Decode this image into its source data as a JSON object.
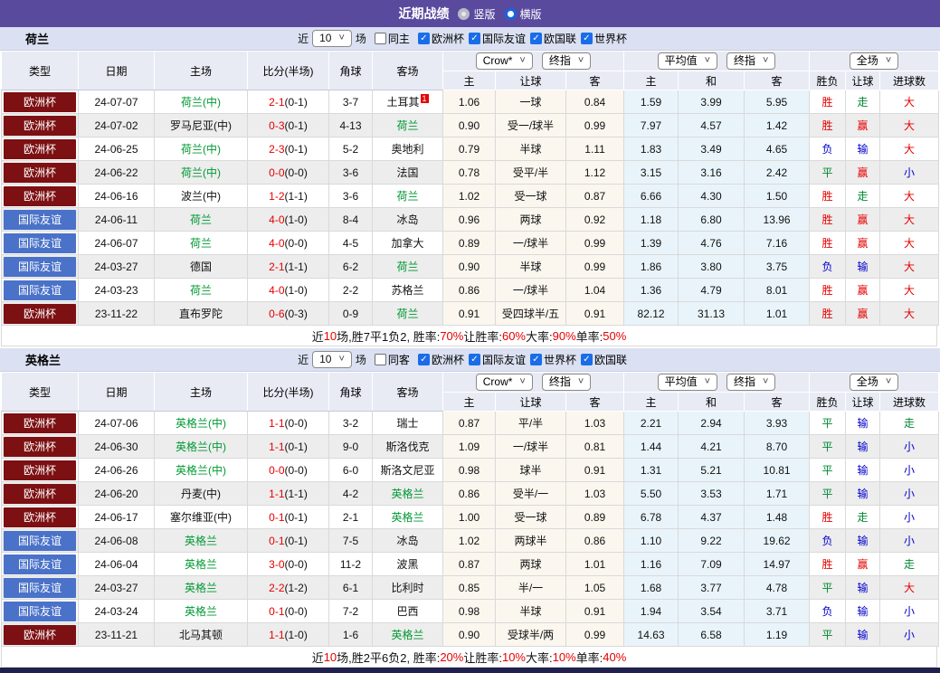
{
  "colors": {
    "title_bar": "#5a4a9e",
    "team_bar": "#dbe1f2",
    "header_cell": "#e8ebf4",
    "euro_badge": "#7c1012",
    "friendly_badge": "#4a72c8",
    "green_team": "#009933",
    "green_result": "#008833",
    "red_text": "#e60000",
    "blue_text": "#0000cc",
    "cream_bg": "#fbf7ef",
    "lightblue_bg": "#e9f4fa",
    "stripe": "#ededed",
    "checkbox_blue": "#1a6de8",
    "bottom_strip": "#20204e"
  },
  "title_bar": {
    "title": "近期战绩",
    "radio_vertical": "竖版",
    "radio_horizontal": "横版"
  },
  "columns": {
    "left": [
      "类型",
      "日期",
      "主场",
      "比分(半场)",
      "角球",
      "客场"
    ],
    "sub": [
      "主",
      "让球",
      "客",
      "主",
      "和",
      "客",
      "胜负",
      "让球",
      "进球数"
    ],
    "dropdowns": {
      "company": "Crow*",
      "final1": "终指",
      "avg": "平均值",
      "final2": "终指",
      "scope": "全场"
    }
  },
  "tables": [
    {
      "team": "荷兰",
      "filter": {
        "near": "近",
        "count": "10",
        "unit": "场",
        "same": "同主",
        "leagues": [
          "欧洲杯",
          "国际友谊",
          "欧国联",
          "世界杯"
        ]
      },
      "rows": [
        {
          "type": "欧洲杯",
          "date": "24-07-07",
          "home": "荷兰(中)",
          "hg": 1,
          "score": "2-1",
          "half": "(0-1)",
          "corner": "3-7",
          "away": "土耳其",
          "ag": 0,
          "note": "1",
          "o1": "1.06",
          "hc": "一球",
          "o2": "0.84",
          "m1": "1.59",
          "m2": "3.99",
          "m3": "5.95",
          "r1": "胜",
          "r2": "走",
          "r3": "大"
        },
        {
          "type": "欧洲杯",
          "date": "24-07-02",
          "home": "罗马尼亚(中)",
          "hg": 0,
          "score": "0-3",
          "half": "(0-1)",
          "corner": "4-13",
          "away": "荷兰",
          "ag": 1,
          "o1": "0.90",
          "hc": "受一/球半",
          "o2": "0.99",
          "m1": "7.97",
          "m2": "4.57",
          "m3": "1.42",
          "r1": "胜",
          "r2": "赢",
          "r3": "大"
        },
        {
          "type": "欧洲杯",
          "date": "24-06-25",
          "home": "荷兰(中)",
          "hg": 1,
          "score": "2-3",
          "half": "(0-1)",
          "corner": "5-2",
          "away": "奥地利",
          "ag": 0,
          "o1": "0.79",
          "hc": "半球",
          "o2": "1.11",
          "m1": "1.83",
          "m2": "3.49",
          "m3": "4.65",
          "r1": "负",
          "r2": "输",
          "r3": "大"
        },
        {
          "type": "欧洲杯",
          "date": "24-06-22",
          "home": "荷兰(中)",
          "hg": 1,
          "score": "0-0",
          "half": "(0-0)",
          "corner": "3-6",
          "away": "法国",
          "ag": 0,
          "o1": "0.78",
          "hc": "受平/半",
          "o2": "1.12",
          "m1": "3.15",
          "m2": "3.16",
          "m3": "2.42",
          "r1": "平",
          "r2": "赢",
          "r3": "小"
        },
        {
          "type": "欧洲杯",
          "date": "24-06-16",
          "home": "波兰(中)",
          "hg": 0,
          "score": "1-2",
          "half": "(1-1)",
          "corner": "3-6",
          "away": "荷兰",
          "ag": 1,
          "o1": "1.02",
          "hc": "受一球",
          "o2": "0.87",
          "m1": "6.66",
          "m2": "4.30",
          "m3": "1.50",
          "r1": "胜",
          "r2": "走",
          "r3": "大"
        },
        {
          "type": "国际友谊",
          "date": "24-06-11",
          "home": "荷兰",
          "hg": 1,
          "score": "4-0",
          "half": "(1-0)",
          "corner": "8-4",
          "away": "冰岛",
          "ag": 0,
          "o1": "0.96",
          "hc": "两球",
          "o2": "0.92",
          "m1": "1.18",
          "m2": "6.80",
          "m3": "13.96",
          "r1": "胜",
          "r2": "赢",
          "r3": "大"
        },
        {
          "type": "国际友谊",
          "date": "24-06-07",
          "home": "荷兰",
          "hg": 1,
          "score": "4-0",
          "half": "(0-0)",
          "corner": "4-5",
          "away": "加拿大",
          "ag": 0,
          "o1": "0.89",
          "hc": "一/球半",
          "o2": "0.99",
          "m1": "1.39",
          "m2": "4.76",
          "m3": "7.16",
          "r1": "胜",
          "r2": "赢",
          "r3": "大"
        },
        {
          "type": "国际友谊",
          "date": "24-03-27",
          "home": "德国",
          "hg": 0,
          "score": "2-1",
          "half": "(1-1)",
          "corner": "6-2",
          "away": "荷兰",
          "ag": 1,
          "o1": "0.90",
          "hc": "半球",
          "o2": "0.99",
          "m1": "1.86",
          "m2": "3.80",
          "m3": "3.75",
          "r1": "负",
          "r2": "输",
          "r3": "大"
        },
        {
          "type": "国际友谊",
          "date": "24-03-23",
          "home": "荷兰",
          "hg": 1,
          "score": "4-0",
          "half": "(1-0)",
          "corner": "2-2",
          "away": "苏格兰",
          "ag": 0,
          "o1": "0.86",
          "hc": "一/球半",
          "o2": "1.04",
          "m1": "1.36",
          "m2": "4.79",
          "m3": "8.01",
          "r1": "胜",
          "r2": "赢",
          "r3": "大"
        },
        {
          "type": "欧洲杯",
          "date": "23-11-22",
          "home": "直布罗陀",
          "hg": 0,
          "score": "0-6",
          "half": "(0-3)",
          "corner": "0-9",
          "away": "荷兰",
          "ag": 1,
          "o1": "0.91",
          "hc": "受四球半/五",
          "o2": "0.91",
          "m1": "82.12",
          "m2": "31.13",
          "m3": "1.01",
          "r1": "胜",
          "r2": "赢",
          "r3": "大"
        }
      ],
      "summary": [
        {
          "t": "近"
        },
        {
          "t": "10",
          "r": 1
        },
        {
          "t": "场,胜7平1负2, 胜率:"
        },
        {
          "t": "70%",
          "r": 1
        },
        {
          "t": " 让胜率:"
        },
        {
          "t": "60%",
          "r": 1
        },
        {
          "t": " 大率:"
        },
        {
          "t": "90%",
          "r": 1
        },
        {
          "t": " 单率:"
        },
        {
          "t": "50%",
          "r": 1
        }
      ]
    },
    {
      "team": "英格兰",
      "filter": {
        "near": "近",
        "count": "10",
        "unit": "场",
        "same": "同客",
        "leagues": [
          "欧洲杯",
          "国际友谊",
          "世界杯",
          "欧国联"
        ]
      },
      "rows": [
        {
          "type": "欧洲杯",
          "date": "24-07-06",
          "home": "英格兰(中)",
          "hg": 1,
          "score": "1-1",
          "half": "(0-0)",
          "corner": "3-2",
          "away": "瑞士",
          "ag": 0,
          "o1": "0.87",
          "hc": "平/半",
          "o2": "1.03",
          "m1": "2.21",
          "m2": "2.94",
          "m3": "3.93",
          "r1": "平",
          "r2": "输",
          "r3": "走"
        },
        {
          "type": "欧洲杯",
          "date": "24-06-30",
          "home": "英格兰(中)",
          "hg": 1,
          "score": "1-1",
          "half": "(0-1)",
          "corner": "9-0",
          "away": "斯洛伐克",
          "ag": 0,
          "o1": "1.09",
          "hc": "一/球半",
          "o2": "0.81",
          "m1": "1.44",
          "m2": "4.21",
          "m3": "8.70",
          "r1": "平",
          "r2": "输",
          "r3": "小"
        },
        {
          "type": "欧洲杯",
          "date": "24-06-26",
          "home": "英格兰(中)",
          "hg": 1,
          "score": "0-0",
          "half": "(0-0)",
          "corner": "6-0",
          "away": "斯洛文尼亚",
          "ag": 0,
          "o1": "0.98",
          "hc": "球半",
          "o2": "0.91",
          "m1": "1.31",
          "m2": "5.21",
          "m3": "10.81",
          "r1": "平",
          "r2": "输",
          "r3": "小"
        },
        {
          "type": "欧洲杯",
          "date": "24-06-20",
          "home": "丹麦(中)",
          "hg": 0,
          "score": "1-1",
          "half": "(1-1)",
          "corner": "4-2",
          "away": "英格兰",
          "ag": 1,
          "o1": "0.86",
          "hc": "受半/一",
          "o2": "1.03",
          "m1": "5.50",
          "m2": "3.53",
          "m3": "1.71",
          "r1": "平",
          "r2": "输",
          "r3": "小"
        },
        {
          "type": "欧洲杯",
          "date": "24-06-17",
          "home": "塞尔维亚(中)",
          "hg": 0,
          "score": "0-1",
          "half": "(0-1)",
          "corner": "2-1",
          "away": "英格兰",
          "ag": 1,
          "o1": "1.00",
          "hc": "受一球",
          "o2": "0.89",
          "m1": "6.78",
          "m2": "4.37",
          "m3": "1.48",
          "r1": "胜",
          "r2": "走",
          "r3": "小"
        },
        {
          "type": "国际友谊",
          "date": "24-06-08",
          "home": "英格兰",
          "hg": 1,
          "score": "0-1",
          "half": "(0-1)",
          "corner": "7-5",
          "away": "冰岛",
          "ag": 0,
          "o1": "1.02",
          "hc": "两球半",
          "o2": "0.86",
          "m1": "1.10",
          "m2": "9.22",
          "m3": "19.62",
          "r1": "负",
          "r2": "输",
          "r3": "小"
        },
        {
          "type": "国际友谊",
          "date": "24-06-04",
          "home": "英格兰",
          "hg": 1,
          "score": "3-0",
          "half": "(0-0)",
          "corner": "11-2",
          "away": "波黑",
          "ag": 0,
          "o1": "0.87",
          "hc": "两球",
          "o2": "1.01",
          "m1": "1.16",
          "m2": "7.09",
          "m3": "14.97",
          "r1": "胜",
          "r2": "赢",
          "r3": "走"
        },
        {
          "type": "国际友谊",
          "date": "24-03-27",
          "home": "英格兰",
          "hg": 1,
          "score": "2-2",
          "half": "(1-2)",
          "corner": "6-1",
          "away": "比利时",
          "ag": 0,
          "o1": "0.85",
          "hc": "半/一",
          "o2": "1.05",
          "m1": "1.68",
          "m2": "3.77",
          "m3": "4.78",
          "r1": "平",
          "r2": "输",
          "r3": "大"
        },
        {
          "type": "国际友谊",
          "date": "24-03-24",
          "home": "英格兰",
          "hg": 1,
          "score": "0-1",
          "half": "(0-0)",
          "corner": "7-2",
          "away": "巴西",
          "ag": 0,
          "o1": "0.98",
          "hc": "半球",
          "o2": "0.91",
          "m1": "1.94",
          "m2": "3.54",
          "m3": "3.71",
          "r1": "负",
          "r2": "输",
          "r3": "小"
        },
        {
          "type": "欧洲杯",
          "date": "23-11-21",
          "home": "北马其顿",
          "hg": 0,
          "score": "1-1",
          "half": "(1-0)",
          "corner": "1-6",
          "away": "英格兰",
          "ag": 1,
          "o1": "0.90",
          "hc": "受球半/两",
          "o2": "0.99",
          "m1": "14.63",
          "m2": "6.58",
          "m3": "1.19",
          "r1": "平",
          "r2": "输",
          "r3": "小"
        }
      ],
      "summary": [
        {
          "t": "近"
        },
        {
          "t": "10",
          "r": 1
        },
        {
          "t": "场,胜2平6负2, 胜率:"
        },
        {
          "t": "20%",
          "r": 1
        },
        {
          "t": " 让胜率:"
        },
        {
          "t": "10%",
          "r": 1
        },
        {
          "t": " 大率:"
        },
        {
          "t": "10%",
          "r": 1
        },
        {
          "t": " 单率:"
        },
        {
          "t": "40%",
          "r": 1
        }
      ]
    }
  ]
}
